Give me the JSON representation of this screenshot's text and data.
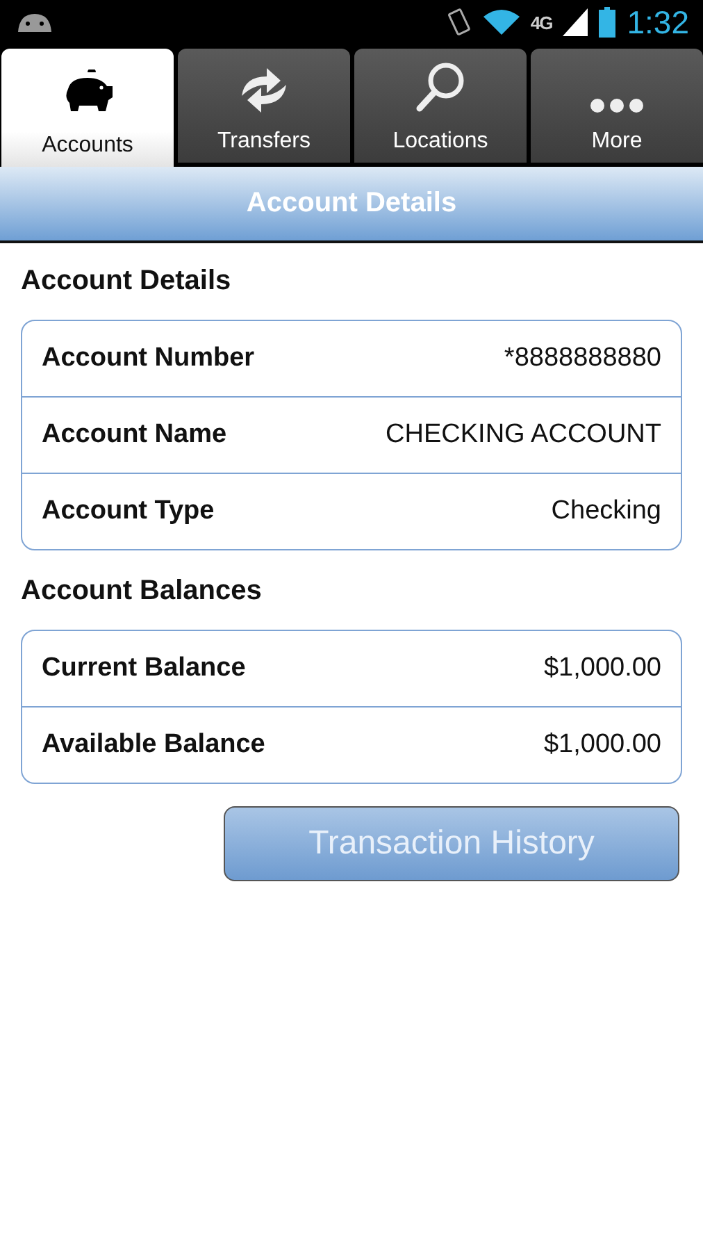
{
  "status_bar": {
    "network": "4G",
    "time": "1:32"
  },
  "tabs": [
    {
      "label": "Accounts",
      "kind": "piggy",
      "selected": true
    },
    {
      "label": "Transfers",
      "kind": "arrows",
      "selected": false
    },
    {
      "label": "Locations",
      "kind": "search",
      "selected": false
    },
    {
      "label": "More",
      "kind": "dots",
      "selected": false
    }
  ],
  "header": {
    "title": "Account Details"
  },
  "sections": [
    {
      "title": "Account Details",
      "rows": [
        {
          "label": "Account Number",
          "value": "*8888888880"
        },
        {
          "label": "Account Name",
          "value": "CHECKING ACCOUNT"
        },
        {
          "label": "Account Type",
          "value": "Checking"
        }
      ]
    },
    {
      "title": "Account Balances",
      "rows": [
        {
          "label": "Current Balance",
          "value": "$1,000.00"
        },
        {
          "label": "Available Balance",
          "value": "$1,000.00"
        }
      ]
    }
  ],
  "button": {
    "label": "Transaction History"
  }
}
